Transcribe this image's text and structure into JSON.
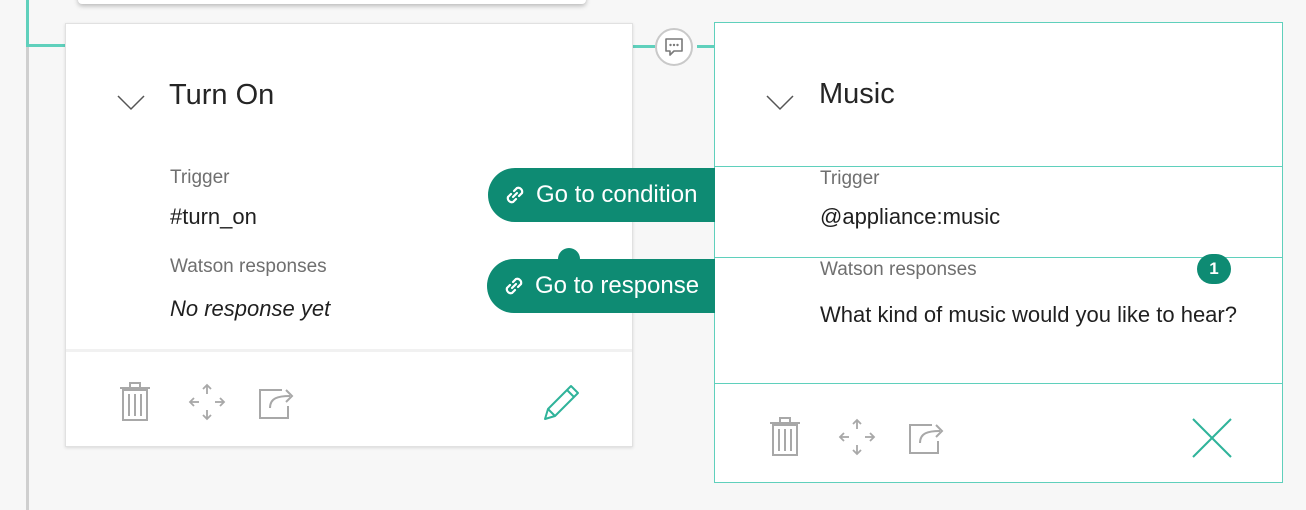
{
  "left_node": {
    "title": "Turn On",
    "trigger_label": "Trigger",
    "trigger_value": "#turn_on",
    "responses_label": "Watson responses",
    "responses_value": "No response yet"
  },
  "right_node": {
    "title": "Music",
    "trigger_label": "Trigger",
    "trigger_value": "@appliance:music",
    "responses_label": "Watson responses",
    "responses_value": "What kind of music would you like to hear?",
    "response_count": "1"
  },
  "jump_to": {
    "go_to_condition_label": "Go to condition",
    "go_to_response_label": "Go to response"
  },
  "colors": {
    "accent": "#0e8b73",
    "connector": "#5fd0bc"
  },
  "icons": [
    "chevron-down-icon",
    "chat-bubble-icon",
    "link-icon",
    "trash-icon",
    "move-icon",
    "jump-to-icon",
    "edit-pencil-icon",
    "close-icon"
  ]
}
